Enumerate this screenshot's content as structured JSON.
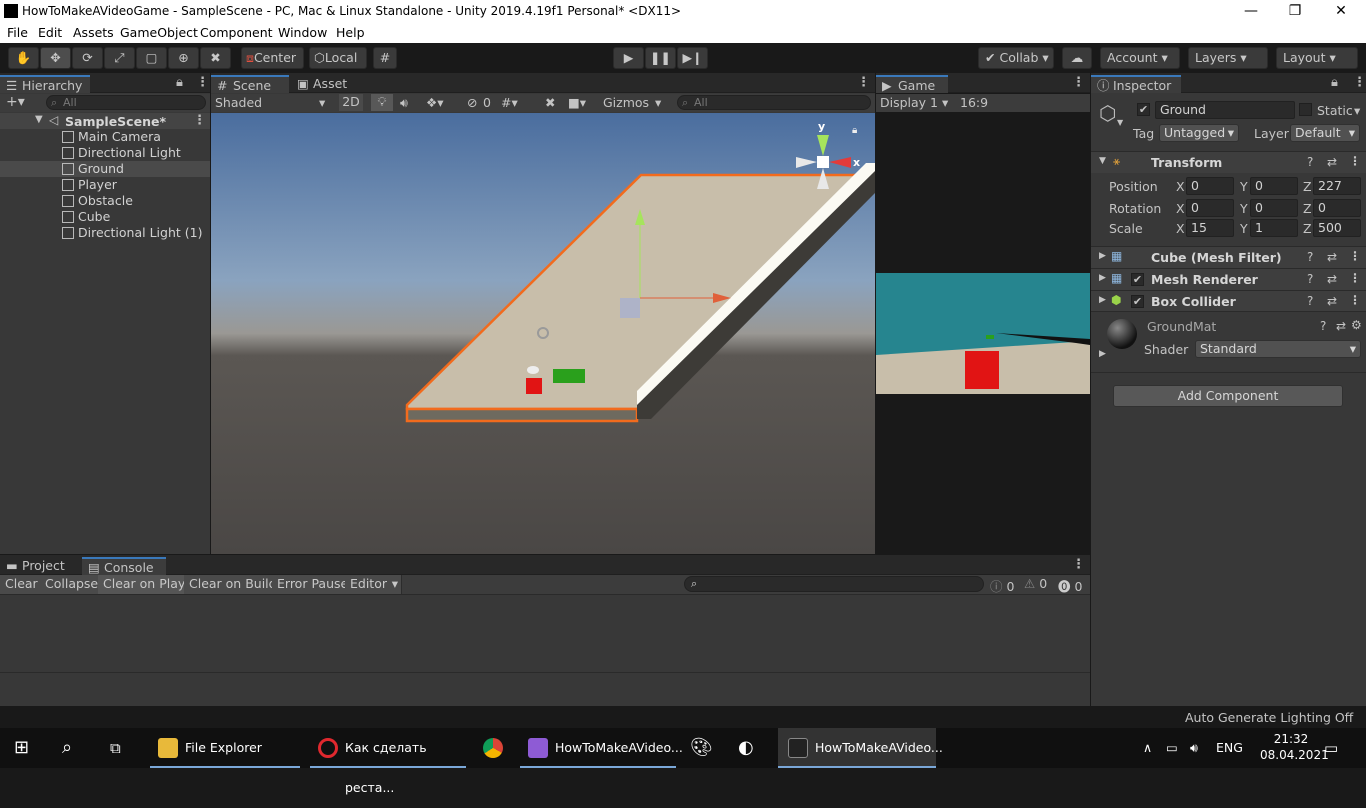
{
  "window": {
    "title": "HowToMakeAVideoGame - SampleScene - PC, Mac & Linux Standalone - Unity 2019.4.19f1 Personal* <DX11>",
    "minimize": "—",
    "maximize": "❐",
    "close": "✕"
  },
  "menu": [
    "File",
    "Edit",
    "Assets",
    "GameObject",
    "Component",
    "Window",
    "Help"
  ],
  "toolbar": {
    "center_label": "Center",
    "local_label": "Local",
    "collab_label": "Collab",
    "account_label": "Account",
    "layers_label": "Layers",
    "layout_label": "Layout"
  },
  "hierarchy": {
    "tab": "Hierarchy",
    "search_placeholder": "All",
    "scene": "SampleScene*",
    "items": [
      "Main Camera",
      "Directional Light",
      "Ground",
      "Player",
      "Obstacle",
      "Cube",
      "Directional Light (1)"
    ],
    "selected": "Ground"
  },
  "scene_view": {
    "tabs": [
      "Scene",
      "Asset Store"
    ],
    "shading": "Shaded",
    "mode_2d": "2D",
    "hidden_count": "0",
    "gizmos": "Gizmos",
    "search_placeholder": "All",
    "gizmo_y": "y",
    "gizmo_x": "x"
  },
  "game_view": {
    "tab": "Game",
    "display": "Display 1",
    "aspect": "16:9"
  },
  "inspector": {
    "tab": "Inspector",
    "object_name": "Ground",
    "static_label": "Static",
    "tag_label": "Tag",
    "tag_value": "Untagged",
    "layer_label": "Layer",
    "layer_value": "Default",
    "transform": {
      "title": "Transform",
      "position": {
        "label": "Position",
        "x": "0",
        "y": "0",
        "z": "227"
      },
      "rotation": {
        "label": "Rotation",
        "x": "0",
        "y": "0",
        "z": "0"
      },
      "scale": {
        "label": "Scale",
        "x": "15",
        "y": "1",
        "z": "500"
      }
    },
    "components": [
      "Cube (Mesh Filter)",
      "Mesh Renderer",
      "Box Collider"
    ],
    "material": {
      "name": "GroundMat",
      "shader_label": "Shader",
      "shader_value": "Standard"
    },
    "add_component": "Add Component"
  },
  "console": {
    "tabs": [
      "Project",
      "Console"
    ],
    "buttons": [
      "Clear",
      "Collapse",
      "Clear on Play",
      "Clear on Build",
      "Error Pause",
      "Editor"
    ],
    "log_count": "0",
    "warn_count": "0",
    "error_count": "0"
  },
  "status_bar": {
    "text": "Auto Generate Lighting Off"
  },
  "taskbar": {
    "items": [
      {
        "label": "File Explorer"
      },
      {
        "label": "Как сделать реста..."
      },
      {
        "label": "HowToMakeAVideo..."
      },
      {
        "label": "HowToMakeAVideo..."
      }
    ],
    "lang": "ENG",
    "time": "21:32",
    "date": "08.04.2021"
  },
  "colors": {
    "accent": "#3a79bb",
    "selection_outline": "#f26b1d",
    "game_sky": "#26858f",
    "ground": "#c8beaa",
    "player": "#e11414",
    "obstacle": "#2aa01c"
  }
}
